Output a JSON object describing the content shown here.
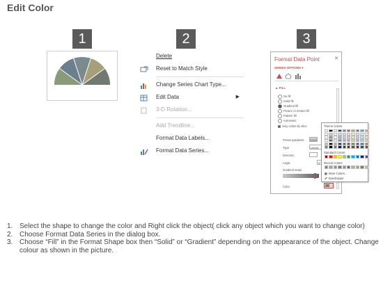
{
  "title": "Edit Color",
  "steps": [
    "1",
    "2",
    "3"
  ],
  "context_menu": {
    "items": [
      {
        "label": "Delete",
        "icon": "none",
        "disabled": false
      },
      {
        "label": "Reset to Match Style",
        "icon": "reset-style-icon",
        "disabled": false
      },
      {
        "label": "Change Series Chart Type...",
        "icon": "chart-type-icon",
        "disabled": false
      },
      {
        "label": "Edit Data",
        "icon": "edit-data-icon",
        "disabled": false,
        "submenu": true
      },
      {
        "label": "3-D Rotation...",
        "icon": "rotation-icon",
        "disabled": true
      },
      {
        "label": "Add Trendline...",
        "icon": "none",
        "disabled": true
      },
      {
        "label": "Format Data Labels...",
        "icon": "none",
        "disabled": false
      },
      {
        "label": "Format Data Series...",
        "icon": "format-series-icon",
        "disabled": false
      }
    ]
  },
  "format_panel": {
    "title": "Format Data Point",
    "series_options": "SERIES OPTIONS ▾",
    "fill_section": "▲ FILL",
    "fill_options": [
      "No fill",
      "Solid fill",
      "Gradient fill",
      "Picture or texture fill",
      "Pattern fill",
      "Automatic"
    ],
    "selected_fill": "Gradient fill",
    "vary_colors": "Vary colors by slice",
    "preset_gradients": "Preset gradients",
    "type_label": "Type",
    "type_value": "Linear",
    "direction_label": "Direction",
    "angle_label": "Angle",
    "angle_value": "0°",
    "gradient_stops": "Gradient stops",
    "color_label": "Color"
  },
  "palette": {
    "theme_colors": "Theme Colors",
    "standard_colors": "Standard Colors",
    "recent_colors": "Recent Colors",
    "more_colors": "More Colors...",
    "eyedropper": "Eyedropper",
    "theme_top": [
      "#ffffff",
      "#000000",
      "#eeece1",
      "#1f497d",
      "#4f81bd",
      "#c0504d",
      "#9bbb59",
      "#8064a2",
      "#4bacc6",
      "#f79646"
    ],
    "standard": [
      "#c00000",
      "#ff0000",
      "#ffc000",
      "#ffff00",
      "#92d050",
      "#00b050",
      "#00b0f0",
      "#0070c0",
      "#002060",
      "#7030a0"
    ],
    "recent": [
      "#7f7f7f",
      "#a5a5a5",
      "#8c9c8a",
      "#6d7b8d",
      "#939393",
      "#5f6b6b",
      "#b8b08d",
      "#9aa39a",
      "#707e7e",
      "#c9b78f"
    ]
  },
  "instructions": [
    {
      "num": "1.",
      "text": "Select the shape to change the color and Right click the object( click any object which you want to change color)"
    },
    {
      "num": "2.",
      "text": "Choose Format Data Series in the dialog box."
    },
    {
      "num": "3.",
      "text": "Choose “Fill” in the Format Shape box then “Solid” or “Gradient” depending on the appearance of the object. Change colour as shown in the picture."
    }
  ]
}
